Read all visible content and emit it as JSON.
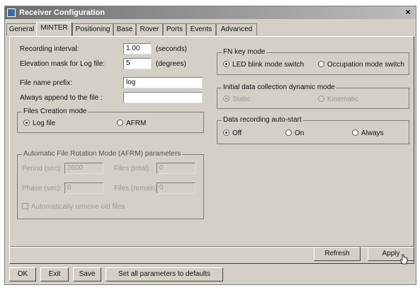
{
  "window": {
    "title": "Receiver Configuration",
    "close_label": "×"
  },
  "tabs": [
    "General",
    "MINTER",
    "Positioning",
    "Base",
    "Rover",
    "Ports",
    "Events",
    "Advanced"
  ],
  "form": {
    "recording_interval_label": "Recording interval:",
    "recording_interval_value": "1.00",
    "recording_interval_unit": "(seconds)",
    "elevation_mask_label": "Elevation mask for Log file:",
    "elevation_mask_value": "5",
    "elevation_mask_unit": "(degrees)",
    "file_prefix_label": "File name prefix:",
    "file_prefix_value": "log",
    "append_label": "Always append to the file :",
    "append_value": ""
  },
  "files_creation": {
    "title": "Files Creation mode",
    "options": [
      "Log file",
      "AFRM"
    ],
    "selected": "Log file"
  },
  "afrm": {
    "title": "Automatic File Rotation Mode (AFRM) parameters",
    "period_label": "Period (sec):",
    "period_value": "3600",
    "files_total_label": "Files (total) :",
    "files_total_value": "0",
    "phase_label": "Phase (sec):",
    "phase_value": "0",
    "files_remain_label": "Files (remain):",
    "files_remain_value": "0",
    "auto_remove_label": "Automatically remove old files"
  },
  "fn_key": {
    "title": "FN key mode",
    "options": [
      "LED blink mode switch",
      "Occupation mode switch"
    ],
    "selected": "LED blink mode switch"
  },
  "dynamic_mode": {
    "title": "Initial data collection dynamic mode",
    "options": [
      "Static",
      "Kinematic"
    ],
    "selected": "Static"
  },
  "auto_start": {
    "title": "Data recording auto-start",
    "options": [
      "Off",
      "On",
      "Always"
    ],
    "selected": "Off"
  },
  "buttons": {
    "refresh": "Refresh",
    "apply": "Apply",
    "ok": "OK",
    "exit": "Exit",
    "save": "Save",
    "defaults": "Set all parameters to defaults"
  }
}
